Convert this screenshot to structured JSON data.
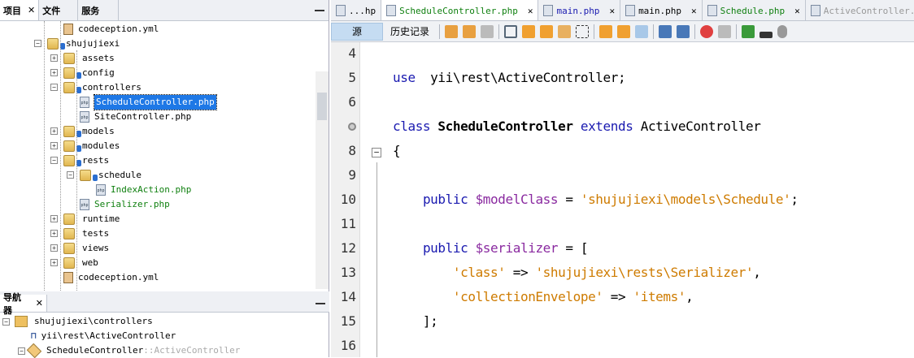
{
  "left_panel": {
    "tabs": [
      {
        "label": "项目"
      },
      {
        "label": "文件"
      },
      {
        "label": "服务"
      }
    ],
    "tree": [
      {
        "label": "codeception.yml",
        "type": "yml",
        "lvl": 2
      },
      {
        "label": "shujujiexi",
        "type": "folder",
        "lvl": 1,
        "badge": true,
        "expanded": true
      },
      {
        "label": "assets",
        "type": "folder",
        "lvl": 2,
        "expanded": false
      },
      {
        "label": "config",
        "type": "folder",
        "lvl": 2,
        "badge": true,
        "expanded": false
      },
      {
        "label": "controllers",
        "type": "folder",
        "lvl": 2,
        "badge": true,
        "expanded": true
      },
      {
        "label": "ScheduleController.php",
        "type": "php",
        "lvl": 3,
        "selected": true
      },
      {
        "label": "SiteController.php",
        "type": "php",
        "lvl": 3
      },
      {
        "label": "models",
        "type": "folder",
        "lvl": 2,
        "badge": true,
        "expanded": false
      },
      {
        "label": "modules",
        "type": "folder",
        "lvl": 2,
        "badge": true,
        "expanded": false
      },
      {
        "label": "rests",
        "type": "folder",
        "lvl": 2,
        "badge": true,
        "expanded": true
      },
      {
        "label": "schedule",
        "type": "folder",
        "lvl": 3,
        "badge": true,
        "expanded": true
      },
      {
        "label": "IndexAction.php",
        "type": "php",
        "lvl": 4,
        "green": true
      },
      {
        "label": "Serializer.php",
        "type": "php",
        "lvl": 3,
        "green": true
      },
      {
        "label": "runtime",
        "type": "folder",
        "lvl": 2,
        "expanded": false
      },
      {
        "label": "tests",
        "type": "folder",
        "lvl": 2,
        "expanded": false
      },
      {
        "label": "views",
        "type": "folder",
        "lvl": 2,
        "expanded": false
      },
      {
        "label": "web",
        "type": "folder",
        "lvl": 2,
        "expanded": false
      },
      {
        "label": "codeception.yml",
        "type": "yml",
        "lvl": 2
      }
    ]
  },
  "navigator": {
    "title": "导航器",
    "namespace": "shujujiexi\\controllers",
    "use": "yii\\rest\\ActiveController",
    "class": "ScheduleController",
    "extends": "::ActiveController"
  },
  "editor": {
    "tabs": [
      {
        "label": "...hp",
        "color": "#000"
      },
      {
        "label": "ScheduleController.php",
        "color": "#108010",
        "active": true
      },
      {
        "label": "main.php",
        "color": "#1a1ab0"
      },
      {
        "label": "main.php",
        "color": "#000"
      },
      {
        "label": "Schedule.php",
        "color": "#108010"
      },
      {
        "label": "ActiveController.php",
        "color": "#999"
      }
    ],
    "toolbar": {
      "source": "源",
      "history": "历史记录"
    },
    "lines": [
      {
        "n": "4",
        "t": []
      },
      {
        "n": "5",
        "t": [
          [
            "kw",
            "use"
          ],
          [
            "",
            "  yii\\rest\\ActiveController;"
          ]
        ]
      },
      {
        "n": "6",
        "t": []
      },
      {
        "n": "",
        "marker": true,
        "t": [
          [
            "kw",
            "class"
          ],
          [
            "",
            " "
          ],
          [
            "b",
            "ScheduleController"
          ],
          [
            "",
            " "
          ],
          [
            "kw",
            "extends"
          ],
          [
            "",
            " ActiveController"
          ]
        ]
      },
      {
        "n": "8",
        "fold": true,
        "t": [
          [
            "",
            "{"
          ]
        ]
      },
      {
        "n": "9",
        "t": []
      },
      {
        "n": "10",
        "t": [
          [
            "",
            "    "
          ],
          [
            "kw",
            "public"
          ],
          [
            "",
            " "
          ],
          [
            "var",
            "$modelClass"
          ],
          [
            "",
            " = "
          ],
          [
            "str",
            "'shujujiexi\\models\\Schedule'"
          ],
          [
            "",
            ";"
          ]
        ]
      },
      {
        "n": "11",
        "t": []
      },
      {
        "n": "12",
        "t": [
          [
            "",
            "    "
          ],
          [
            "kw",
            "public"
          ],
          [
            "",
            " "
          ],
          [
            "var",
            "$serializer"
          ],
          [
            "",
            " = ["
          ]
        ]
      },
      {
        "n": "13",
        "t": [
          [
            "",
            "        "
          ],
          [
            "str",
            "'class'"
          ],
          [
            "",
            " => "
          ],
          [
            "str",
            "'shujujiexi\\rests\\Serializer'"
          ],
          [
            "",
            ","
          ]
        ]
      },
      {
        "n": "14",
        "t": [
          [
            "",
            "        "
          ],
          [
            "str",
            "'collectionEnvelope'"
          ],
          [
            "",
            " => "
          ],
          [
            "str",
            "'items'"
          ],
          [
            "",
            ","
          ]
        ]
      },
      {
        "n": "15",
        "t": [
          [
            "",
            "    ];"
          ]
        ]
      },
      {
        "n": "16",
        "t": []
      }
    ]
  }
}
